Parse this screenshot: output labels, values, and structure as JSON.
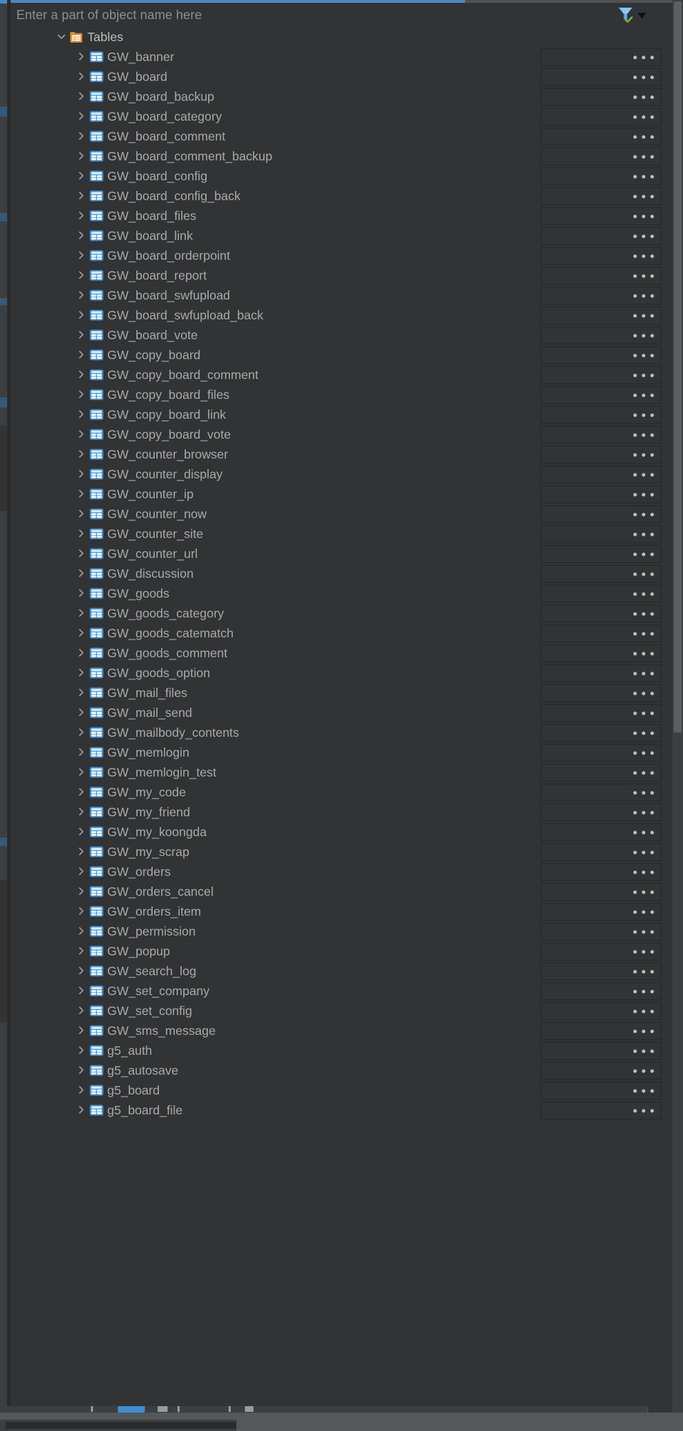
{
  "panel": {
    "title": "database-object-tree",
    "accent_color": "#4a88c7",
    "background_color": "#313335",
    "text_color": "#a9a9a9"
  },
  "search": {
    "placeholder": "Enter a part of object name here",
    "value": ""
  },
  "toolbar": {
    "filter_icon": "filter-funnel-check-icon",
    "filter_icon_color": "#5ba3dd",
    "filter_check_color": "#6cb33f",
    "dropdown_icon": "chevron-down-icon"
  },
  "tree": {
    "group": {
      "label": "Tables",
      "icon": "tables-folder-icon",
      "icon_color": "#e08a28",
      "expanded": true,
      "twisty": "chevron-down-icon"
    },
    "row_twisty": "chevron-right-icon",
    "row_icon": "table-icon",
    "row_icon_color": "#3d8fd1",
    "cell_overflow_label": "...",
    "items": [
      "GW_banner",
      "GW_board",
      "GW_board_backup",
      "GW_board_category",
      "GW_board_comment",
      "GW_board_comment_backup",
      "GW_board_config",
      "GW_board_config_back",
      "GW_board_files",
      "GW_board_link",
      "GW_board_orderpoint",
      "GW_board_report",
      "GW_board_swfupload",
      "GW_board_swfupload_back",
      "GW_board_vote",
      "GW_copy_board",
      "GW_copy_board_comment",
      "GW_copy_board_files",
      "GW_copy_board_link",
      "GW_copy_board_vote",
      "GW_counter_browser",
      "GW_counter_display",
      "GW_counter_ip",
      "GW_counter_now",
      "GW_counter_site",
      "GW_counter_url",
      "GW_discussion",
      "GW_goods",
      "GW_goods_category",
      "GW_goods_catematch",
      "GW_goods_comment",
      "GW_goods_option",
      "GW_mail_files",
      "GW_mail_send",
      "GW_mailbody_contents",
      "GW_memlogin",
      "GW_memlogin_test",
      "GW_my_code",
      "GW_my_friend",
      "GW_my_koongda",
      "GW_my_scrap",
      "GW_orders",
      "GW_orders_cancel",
      "GW_orders_item",
      "GW_permission",
      "GW_popup",
      "GW_search_log",
      "GW_set_company",
      "GW_set_config",
      "GW_sms_message",
      "g5_auth",
      "g5_autosave",
      "g5_board",
      "g5_board_file"
    ]
  },
  "scrollbars": {
    "vertical_position": "top",
    "horizontal_position": "left"
  }
}
